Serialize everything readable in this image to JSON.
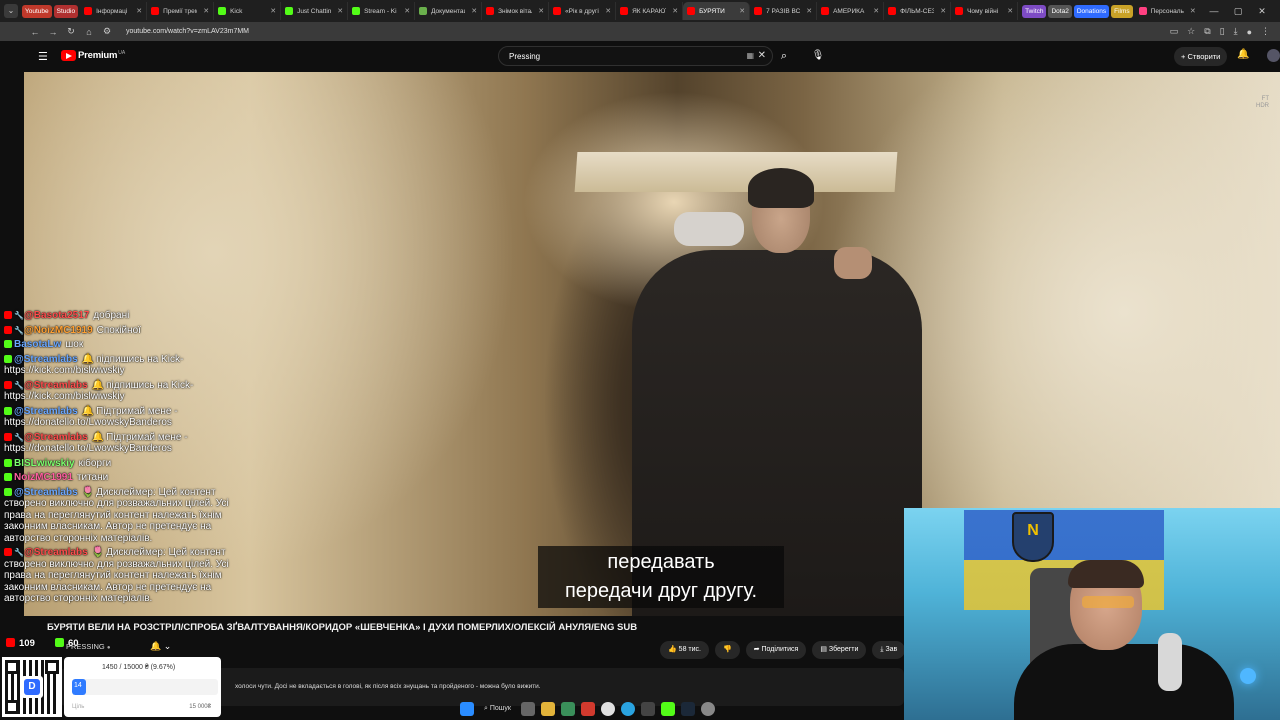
{
  "browser": {
    "bookmark_chips": [
      {
        "label": "Youtube",
        "color": "#c0392b"
      },
      {
        "label": "Studio",
        "color": "#b03030"
      }
    ],
    "tabs": [
      {
        "label": "Інформаці",
        "color": "#ff0000"
      },
      {
        "label": "Премії трем",
        "color": "#ff0000"
      },
      {
        "label": "Kick",
        "color": "#53fc18"
      },
      {
        "label": "Just Chattin",
        "color": "#53fc18"
      },
      {
        "label": "Stream - Ki",
        "color": "#53fc18"
      },
      {
        "label": "Документація і історії",
        "color": "#6ab04c"
      },
      {
        "label": "Знімок вітал",
        "color": "#ff0000"
      },
      {
        "label": "«Рік в другі",
        "color": "#ff0000"
      },
      {
        "label": "ЯК КАРАЮТ",
        "color": "#ff0000"
      },
      {
        "label": "БУРЯТИ",
        "color": "#ff0000",
        "active": true
      },
      {
        "label": "7 РАЗІВ ВС",
        "color": "#ff0000"
      },
      {
        "label": "АМЕРИКА",
        "color": "#ff0000"
      },
      {
        "label": "ФІЛЬМ-СЕЗ",
        "color": "#ff0000"
      },
      {
        "label": "Чому війні",
        "color": "#ff0000"
      }
    ],
    "right_chips": [
      {
        "label": "Twitch",
        "color": "#7d4bc4"
      },
      {
        "label": "Dota2",
        "color": "#555555"
      },
      {
        "label": "Donations",
        "color": "#2f6bff"
      },
      {
        "label": "Films",
        "color": "#c9a227"
      }
    ],
    "last_tab": "Персональ",
    "new_tab_icon": "+",
    "url": "youtube.com/watch?v=zmLAV23m7MM"
  },
  "youtube": {
    "logo_text": "Premium",
    "country_code": "UA",
    "search_query": "Pressing",
    "create_label": "Створити",
    "hdr_badge_line1": "FT",
    "hdr_badge_line2": "HDR"
  },
  "video": {
    "subtitle_line1": "передавать",
    "subtitle_line2": "передачи друг другу.",
    "title": "БУРЯТИ ВЕЛИ НА РОЗСТРІЛ/СПРОБА ЗҐВАЛТУВАННЯ/КОРИДОР «ШЕВЧЕНКА» І ДУХИ ПОМЕРЛИХ/ОЛЕКСІЙ АНУЛЯ/ENG SUB",
    "channel": "PRESSING",
    "verified_mark": "●",
    "likes": "58 тис.",
    "share_label": "Поділитися",
    "save_label": "Зберегти",
    "download_label": "Зав",
    "description": "холоси чути. Досі не вкладається в голові, як після всіх знущань та пройденого - можна було вижити."
  },
  "stream_stats": {
    "youtube_viewers": "109",
    "kick_viewers": "60"
  },
  "chat": [
    {
      "platforms": [
        "yt",
        "wrench"
      ],
      "user": "@Basota2517",
      "color": "red",
      "text": "добрані"
    },
    {
      "platforms": [
        "yt",
        "wrench"
      ],
      "user": "@NoizMC1919",
      "color": "orange",
      "text": "Спокійної"
    },
    {
      "platforms": [
        "kick"
      ],
      "user": "BasotaLw",
      "color": "blue",
      "text": "шок"
    },
    {
      "platforms": [
        "kick"
      ],
      "user": "@Streamlabs",
      "color": "blue",
      "emoji": "bell",
      "text": "підпишись на Kick- https://kick.com/bislwiwskiy"
    },
    {
      "platforms": [
        "yt",
        "wrench"
      ],
      "user": "@Streamlabs",
      "color": "red",
      "emoji": "bell",
      "text": "підпишись на Kick- https://kick.com/bislwiwskiy"
    },
    {
      "platforms": [
        "kick"
      ],
      "user": "@Streamlabs",
      "color": "blue",
      "emoji": "bell",
      "text": "Підтримай мене - https://donatello.to/LwowskyBanderos"
    },
    {
      "platforms": [
        "yt",
        "wrench"
      ],
      "user": "@Streamlabs",
      "color": "red",
      "emoji": "bell",
      "text": "Підтримай мене - https://donatello.to/LwowskyBanderos"
    },
    {
      "platforms": [
        "kick"
      ],
      "user": "BISLwiwskiy",
      "color": "green",
      "text": "кіборги"
    },
    {
      "platforms": [
        "kick"
      ],
      "user": "NoizMC1991",
      "color": "pink",
      "text": "титани"
    },
    {
      "platforms": [
        "kick"
      ],
      "user": "@Streamlabs",
      "color": "blue",
      "emoji": "flower",
      "text": "Дисклеймер: Цей контент створено виключно для розважальних цілей. Усі права на переглянутий контент належать їхнім законним власникам. Автор не претендує на авторство сторонніх матеріалів."
    },
    {
      "platforms": [
        "yt",
        "wrench"
      ],
      "user": "@Streamlabs",
      "color": "red",
      "emoji": "flower",
      "text": "Дисклеймер: Цей контент створено виключно для розважальних цілей. Усі права на переглянутий контент належать їхнім законним власникам. Автор не претендує на авторство сторонніх матеріалів."
    }
  ],
  "donation_goal": {
    "progress_text": "1450 / 15000 ₴ (9.67%)",
    "fill_label": "14",
    "progress_percent": 9.67,
    "min_label": "Ціль",
    "max_label": "15 000₴",
    "qr_letter": "D"
  },
  "taskbar": {
    "search_label": "Пошук"
  },
  "webcam": {
    "emblem_glyph": "N"
  }
}
